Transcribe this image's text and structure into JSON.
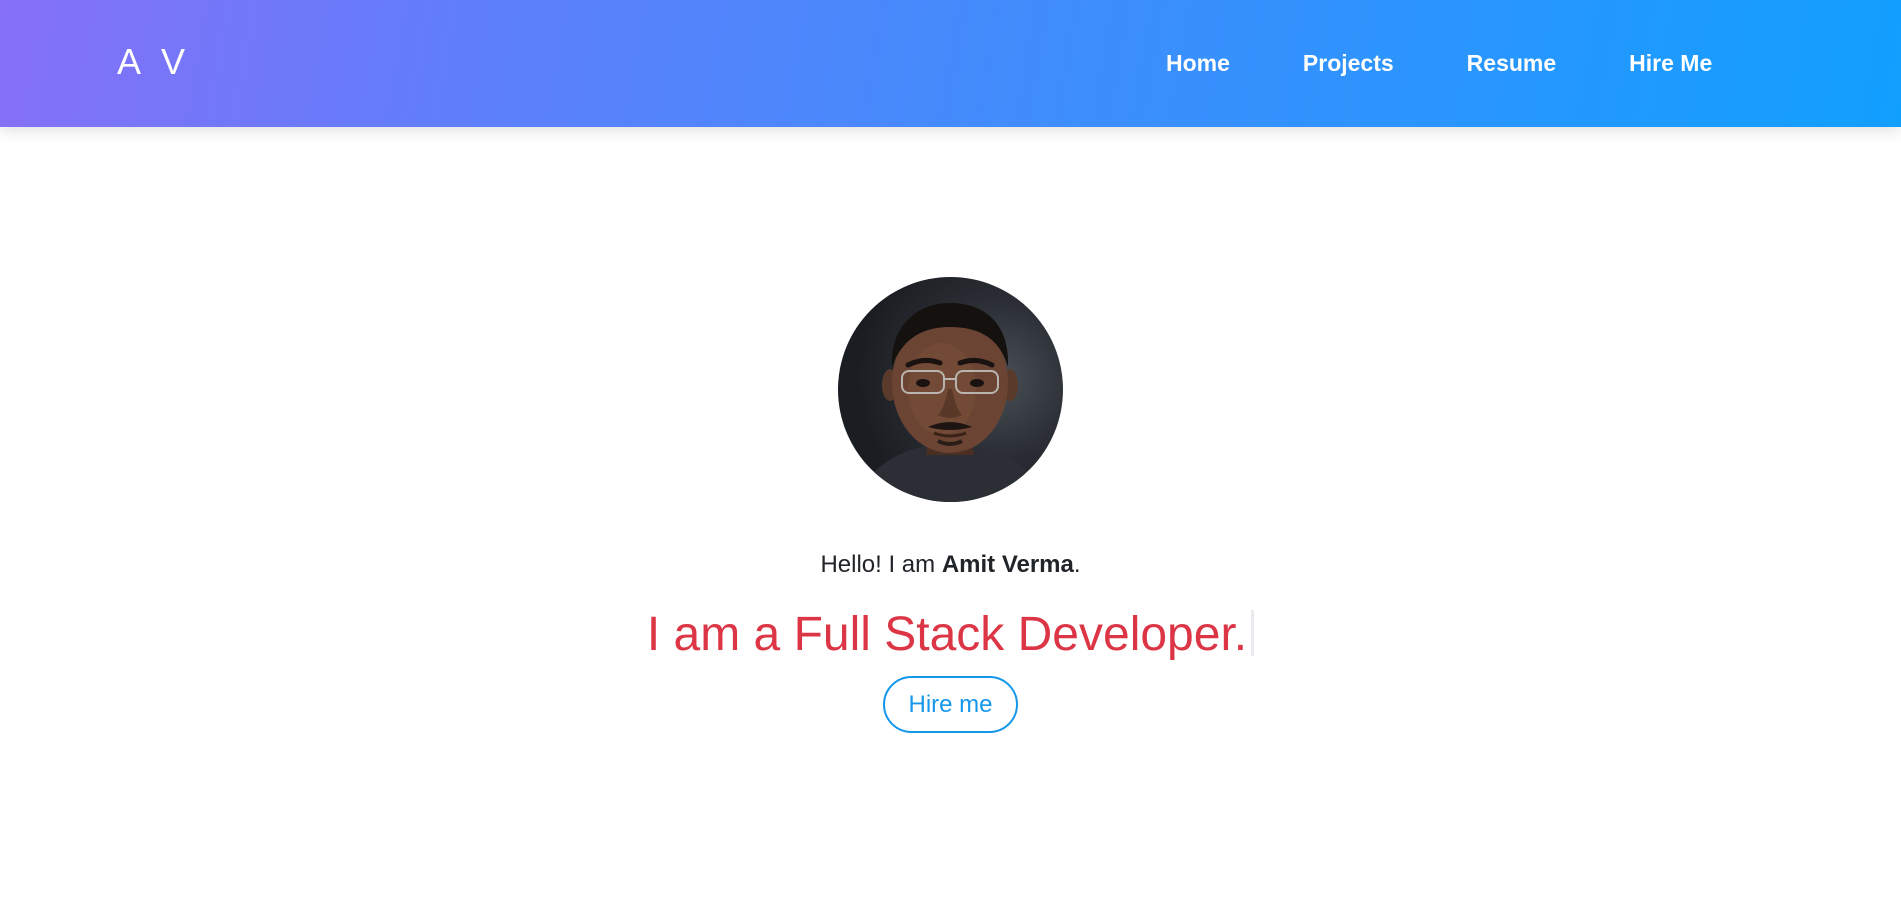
{
  "navbar": {
    "brand": "A V",
    "links": [
      {
        "label": "Home"
      },
      {
        "label": "Projects"
      },
      {
        "label": "Resume"
      },
      {
        "label": "Hire Me"
      }
    ]
  },
  "hero": {
    "greeting_prefix": "Hello! I am ",
    "name": "Amit Verma",
    "greeting_suffix": ".",
    "typed_text": "I am a Full Stack Developer.",
    "cta_label": "Hire me"
  },
  "colors": {
    "gradient_start": "#8570f7",
    "gradient_end": "#119ffe",
    "typed_text": "#dc3545",
    "cta": "#1597ea"
  },
  "icons": {
    "avatar": "profile-photo"
  }
}
